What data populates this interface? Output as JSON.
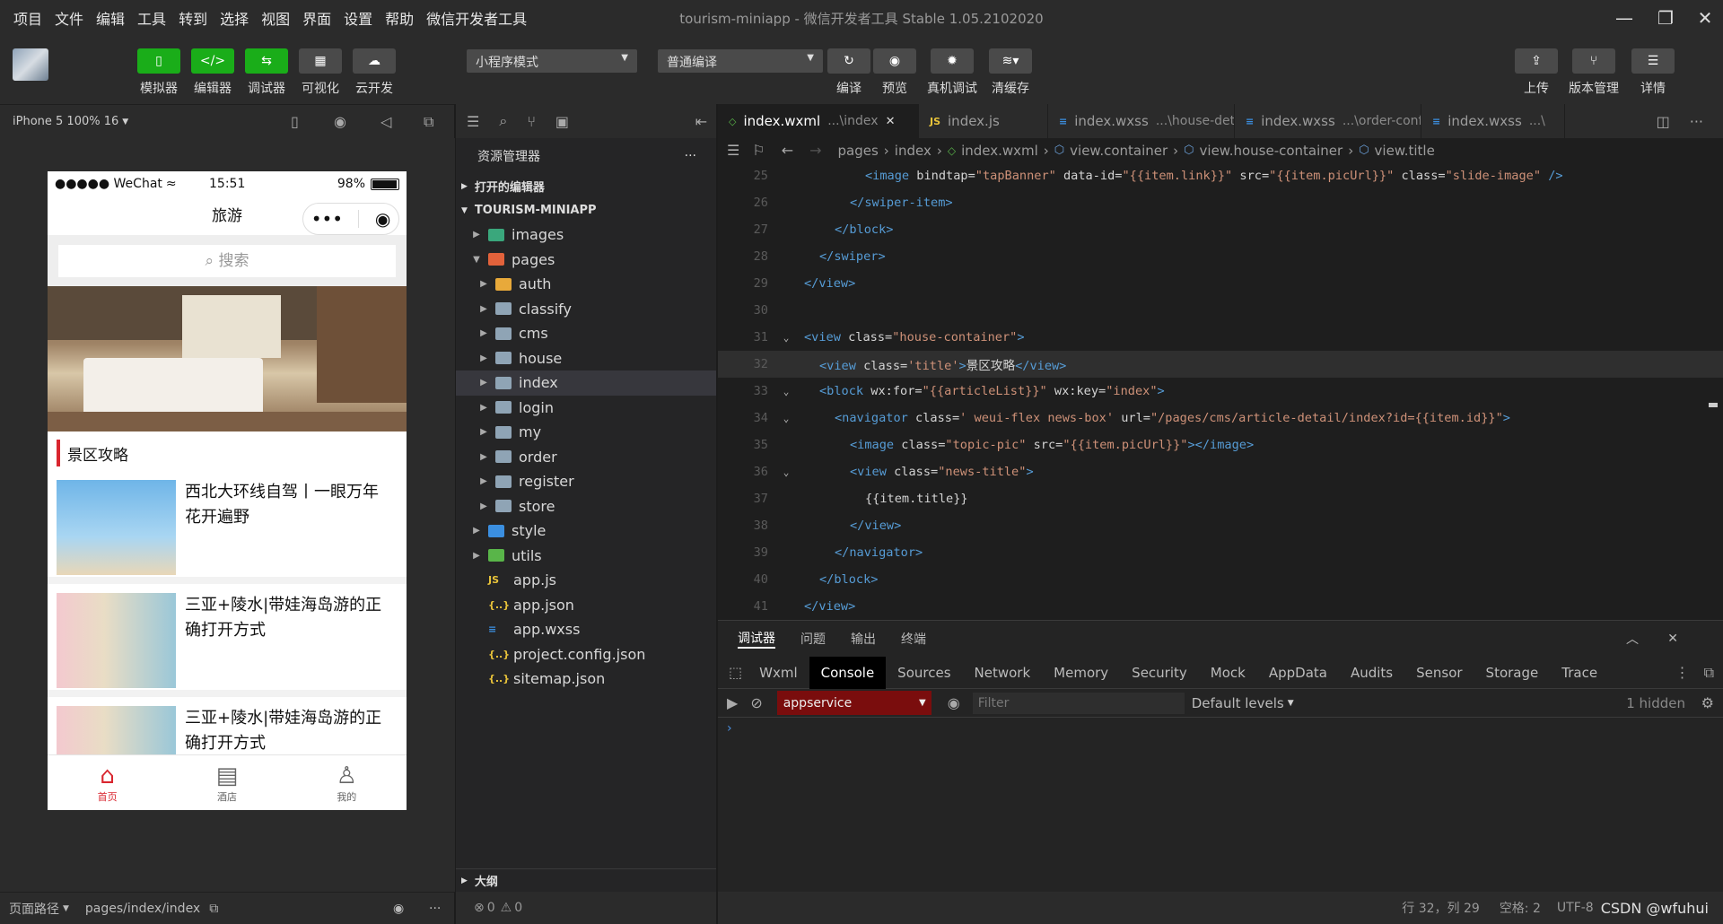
{
  "menu": [
    "项目",
    "文件",
    "编辑",
    "工具",
    "转到",
    "选择",
    "视图",
    "界面",
    "设置",
    "帮助",
    "微信开发者工具"
  ],
  "window_title": "tourism-miniapp - 微信开发者工具 Stable 1.05.2102020",
  "toolbar": {
    "simulator": "模拟器",
    "editor": "编辑器",
    "debugger": "调试器",
    "visual": "可视化",
    "cloud": "云开发",
    "mode_select": "小程序模式",
    "compile_select": "普通编译",
    "compile": "编译",
    "preview": "预览",
    "device_debug": "真机调试",
    "clear_cache": "清缓存",
    "upload": "上传",
    "version": "版本管理",
    "details": "详情"
  },
  "sim": {
    "device": "iPhone 5 100% 16",
    "status_carrier": "●●●●● WeChat",
    "status_time": "15:51",
    "status_battery": "98%",
    "nav_title": "旅游",
    "search_placeholder": "搜索",
    "section_title": "景区攻略",
    "news": [
      {
        "title": "西北大环线自驾丨一眼万年 花开遍野"
      },
      {
        "title": "三亚+陵水|带娃海岛游的正确打开方式"
      },
      {
        "title": "三亚+陵水|带娃海岛游的正确打开方式"
      }
    ],
    "tabs": [
      "首页",
      "酒店",
      "我的"
    ],
    "footer_path_label": "页面路径",
    "footer_path": "pages/index/index"
  },
  "explorer": {
    "title": "资源管理器",
    "open_editors": "打开的编辑器",
    "project": "TOURISM-MINIAPP",
    "items": [
      {
        "name": "images",
        "level": 1,
        "type": "folder-img",
        "expanded": false
      },
      {
        "name": "pages",
        "level": 1,
        "type": "folder-pages",
        "expanded": true
      },
      {
        "name": "auth",
        "level": 2,
        "type": "folder-auth",
        "expanded": false
      },
      {
        "name": "classify",
        "level": 2,
        "type": "folder",
        "expanded": false
      },
      {
        "name": "cms",
        "level": 2,
        "type": "folder",
        "expanded": false
      },
      {
        "name": "house",
        "level": 2,
        "type": "folder",
        "expanded": false
      },
      {
        "name": "index",
        "level": 2,
        "type": "folder",
        "expanded": false,
        "active": true
      },
      {
        "name": "login",
        "level": 2,
        "type": "folder",
        "expanded": false
      },
      {
        "name": "my",
        "level": 2,
        "type": "folder",
        "expanded": false
      },
      {
        "name": "order",
        "level": 2,
        "type": "folder",
        "expanded": false
      },
      {
        "name": "register",
        "level": 2,
        "type": "folder",
        "expanded": false
      },
      {
        "name": "store",
        "level": 2,
        "type": "folder",
        "expanded": false
      },
      {
        "name": "style",
        "level": 1,
        "type": "folder-style",
        "expanded": false
      },
      {
        "name": "utils",
        "level": 1,
        "type": "folder-utils",
        "expanded": false
      },
      {
        "name": "app.js",
        "level": 1,
        "type": "js"
      },
      {
        "name": "app.json",
        "level": 1,
        "type": "json"
      },
      {
        "name": "app.wxss",
        "level": 1,
        "type": "wxss"
      },
      {
        "name": "project.config.json",
        "level": 1,
        "type": "json"
      },
      {
        "name": "sitemap.json",
        "level": 1,
        "type": "json"
      }
    ],
    "outline": "大纲",
    "problems": "0",
    "warnings": "0"
  },
  "editor": {
    "tabs": [
      {
        "name": "index.wxml",
        "path": "...\\index",
        "type": "wxml",
        "active": true
      },
      {
        "name": "index.js",
        "path": "",
        "type": "js"
      },
      {
        "name": "index.wxss",
        "path": "...\\house-detail",
        "type": "wxss"
      },
      {
        "name": "index.wxss",
        "path": "...\\order-confirm",
        "type": "wxss"
      },
      {
        "name": "index.wxss",
        "path": "...\\",
        "type": "wxss"
      }
    ],
    "breadcrumb": [
      "pages",
      "index",
      "index.wxml",
      "view.container",
      "view.house-container",
      "view.title"
    ],
    "lines": [
      {
        "n": "25",
        "fold": "",
        "indent": 4,
        "html": "<span class='t'>&lt;image</span> bindtap=<span class='s'>\"tapBanner\"</span> data-id=<span class='s'>\"{{item.link}}\"</span> src=<span class='s'>\"{{item.picUrl}}\"</span> class=<span class='s'>\"slide-image\"</span> <span class='t'>/&gt;</span>"
      },
      {
        "n": "26",
        "fold": "",
        "indent": 3,
        "html": "<span class='t'>&lt;/swiper-item&gt;</span>"
      },
      {
        "n": "27",
        "fold": "",
        "indent": 2,
        "html": "<span class='t'>&lt;/block&gt;</span>"
      },
      {
        "n": "28",
        "fold": "",
        "indent": 1,
        "html": "<span class='t'>&lt;/swiper&gt;</span>"
      },
      {
        "n": "29",
        "fold": "",
        "indent": 0,
        "html": "<span class='t'>&lt;/view&gt;</span>"
      },
      {
        "n": "30",
        "fold": "",
        "indent": 0,
        "html": ""
      },
      {
        "n": "31",
        "fold": "v",
        "indent": 0,
        "html": "<span class='t'>&lt;view</span> class=<span class='s'>\"house-container\"</span><span class='t'>&gt;</span>"
      },
      {
        "n": "32",
        "fold": "",
        "indent": 1,
        "hl": true,
        "html": "<span class='t'>&lt;view</span> class=<span class='s'>'title'</span><span class='t'>&gt;</span>景区攻略<span class='t'>&lt;/view&gt;</span>"
      },
      {
        "n": "33",
        "fold": "v",
        "indent": 1,
        "html": "<span class='t'>&lt;block</span> wx:for=<span class='s'>\"{{articleList}}\"</span> wx:key=<span class='s'>\"index\"</span><span class='t'>&gt;</span>"
      },
      {
        "n": "34",
        "fold": "v",
        "indent": 2,
        "html": "<span class='t'>&lt;navigator</span> class=<span class='s'>' weui-flex news-box'</span> url=<span class='s'>\"/pages/cms/article-detail/index?id={{item.id}}\"</span><span class='t'>&gt;</span>"
      },
      {
        "n": "35",
        "fold": "",
        "indent": 3,
        "html": "<span class='t'>&lt;image</span> class=<span class='s'>\"topic-pic\"</span> src=<span class='s'>\"{{item.picUrl}}\"</span><span class='t'>&gt;&lt;/image&gt;</span>"
      },
      {
        "n": "36",
        "fold": "v",
        "indent": 3,
        "html": "<span class='t'>&lt;view</span> class=<span class='s'>\"news-title\"</span><span class='t'>&gt;</span>"
      },
      {
        "n": "37",
        "fold": "",
        "indent": 4,
        "html": "{{item.title}}"
      },
      {
        "n": "38",
        "fold": "",
        "indent": 3,
        "html": "<span class='t'>&lt;/view&gt;</span>"
      },
      {
        "n": "39",
        "fold": "",
        "indent": 2,
        "html": "<span class='t'>&lt;/navigator&gt;</span>"
      },
      {
        "n": "40",
        "fold": "",
        "indent": 1,
        "html": "<span class='t'>&lt;/block&gt;</span>"
      },
      {
        "n": "41",
        "fold": "",
        "indent": 0,
        "html": "<span class='t'>&lt;/view&gt;</span>"
      }
    ]
  },
  "devtools": {
    "panel_tabs": [
      "调试器",
      "问题",
      "输出",
      "终端"
    ],
    "tabs": [
      "Wxml",
      "Console",
      "Sources",
      "Network",
      "Memory",
      "Security",
      "Mock",
      "AppData",
      "Audits",
      "Sensor",
      "Storage",
      "Trace"
    ],
    "active_tab": "Console",
    "context": "appservice",
    "filter_placeholder": "Filter",
    "levels": "Default levels",
    "hidden": "1 hidden",
    "prompt": "›"
  },
  "statusbar": {
    "position": "行 32，列 29",
    "spaces": "空格: 2",
    "encoding": "UTF-8",
    "watermark": "CSDN @wfuhui"
  },
  "colors": {
    "accent_green": "#1aad19",
    "tab_red": "#d9262f"
  }
}
